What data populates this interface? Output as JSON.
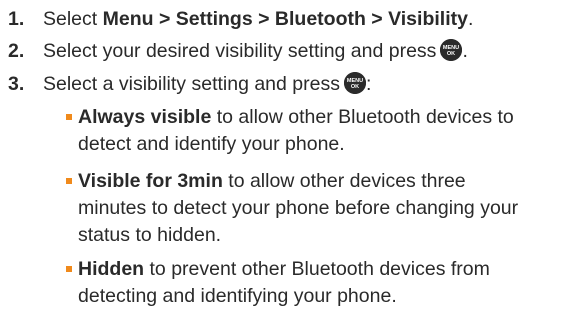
{
  "steps": [
    {
      "number": "1.",
      "prefix": "Select ",
      "bold": "Menu > Settings > Bluetooth > Visibility",
      "suffix": "."
    },
    {
      "number": "2.",
      "text": "Select your desired visibility setting and press",
      "suffix": "."
    },
    {
      "number": "3.",
      "text": "Select a visibility setting and press",
      "suffix": ":"
    }
  ],
  "menu_key": {
    "icon": "menu-ok-key-icon",
    "line1": "MENU",
    "line2": "OK"
  },
  "bullets": [
    {
      "bold": "Always visible",
      "line1_rest": " to allow other Bluetooth devices to",
      "line2": "detect and identify your phone."
    },
    {
      "bold": "Visible for 3min",
      "line1_rest": " to allow other devices three",
      "line2": "minutes to detect your phone before changing your",
      "line3": "status to hidden."
    },
    {
      "bold": "Hidden",
      "line1_rest": " to prevent other Bluetooth devices from",
      "line2": "detecting and identifying your phone."
    }
  ],
  "colors": {
    "text": "#2a2a2a",
    "bullet": "#f08a1c",
    "key": "#2b2b2b"
  }
}
